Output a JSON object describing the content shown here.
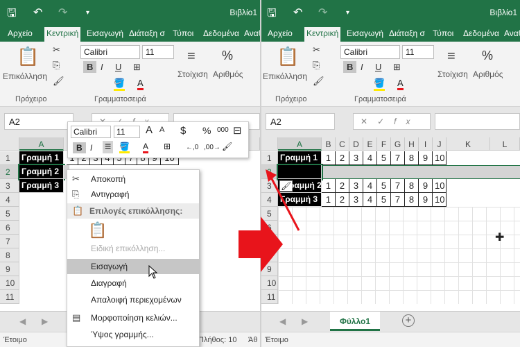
{
  "workbook_title": "Βιβλίο1",
  "ribbon": {
    "tabs": [
      "Αρχείο",
      "Κεντρική",
      "Εισαγωγή",
      "Διάταξη σ",
      "Τύποι",
      "Δεδομένα",
      "Αναθ"
    ],
    "right_tabs": [
      "Αρχείο",
      "Κεντρική",
      "Εισαγωγή",
      "Διάταξη σ",
      "Τύποι",
      "Δεδομένα",
      "Αναθ"
    ],
    "paste_label": "Επικόλληση",
    "clipboard_label": "Πρόχειρο",
    "font_group_label": "Γραμματοσειρά",
    "font_name": "Calibri",
    "font_size": "11",
    "alignment_label": "Στοίχιση",
    "number_label": "Αριθμός",
    "bold": "B",
    "italic": "I",
    "underline": "U",
    "percent": "%"
  },
  "formula_bar": {
    "name_box": "A2",
    "cancel": "✕",
    "enter": "✓",
    "fx": "fx"
  },
  "left_grid": {
    "columns": [
      "A"
    ],
    "rows": [
      "1",
      "2",
      "3",
      "4",
      "5",
      "6",
      "7",
      "8",
      "9",
      "10",
      "11"
    ],
    "labels": [
      "Γραμμή 1",
      "Γραμμή 2",
      "Γραμμή 3"
    ],
    "values": [
      "1",
      "2",
      "3",
      "4",
      "5",
      "7",
      "8",
      "9",
      "10"
    ]
  },
  "right_grid": {
    "columns": [
      "A",
      "B",
      "C",
      "D",
      "E",
      "F",
      "G",
      "H",
      "I",
      "J",
      "K",
      "L"
    ],
    "rows": [
      "1",
      "2",
      "3",
      "4",
      "5",
      "6",
      "7",
      "8",
      "9",
      "10",
      "11"
    ],
    "labels": [
      "Γραμμή 1",
      "Γραμμή 2",
      "Γραμμή 3"
    ],
    "row2_label_partial": "ραμμή 2",
    "values": [
      "1",
      "2",
      "3",
      "4",
      "5",
      "7",
      "8",
      "9",
      "10"
    ]
  },
  "mini_toolbar": {
    "font_name": "Calibri",
    "font_size": "11",
    "grow": "A",
    "shrink": "A",
    "currency": "$",
    "percent": "%",
    "thousands": "000",
    "bold": "B",
    "italic": "I",
    "inc_decimal": "←,0",
    "dec_decimal": ",00→"
  },
  "context_menu": {
    "items": [
      {
        "label": "Αποκοπή",
        "icon": "scissors-icon"
      },
      {
        "label": "Αντιγραφή",
        "icon": "copy-icon"
      },
      {
        "label": "Επιλογές επικόλλησης:",
        "icon": "paste-options-icon"
      },
      {
        "label": "Ειδική επικόλληση...",
        "icon": ""
      },
      {
        "label": "Εισαγωγή",
        "icon": ""
      },
      {
        "label": "Διαγραφή",
        "icon": ""
      },
      {
        "label": "Απαλοιφή περιεχομένων",
        "icon": ""
      },
      {
        "label": "Μορφοποίηση κελιών...",
        "icon": "format-cells-icon"
      },
      {
        "label": "Ύψος γραμμής...",
        "icon": ""
      }
    ]
  },
  "sheet_tab": "Φύλλο1",
  "add_sheet": "+",
  "status": {
    "ready": "Έτοιμο",
    "count_left": "Πλήθος: 10",
    "cut_left": "Άθ"
  },
  "colors": {
    "excel_green": "#217346",
    "arrow_red": "#e8141b"
  }
}
